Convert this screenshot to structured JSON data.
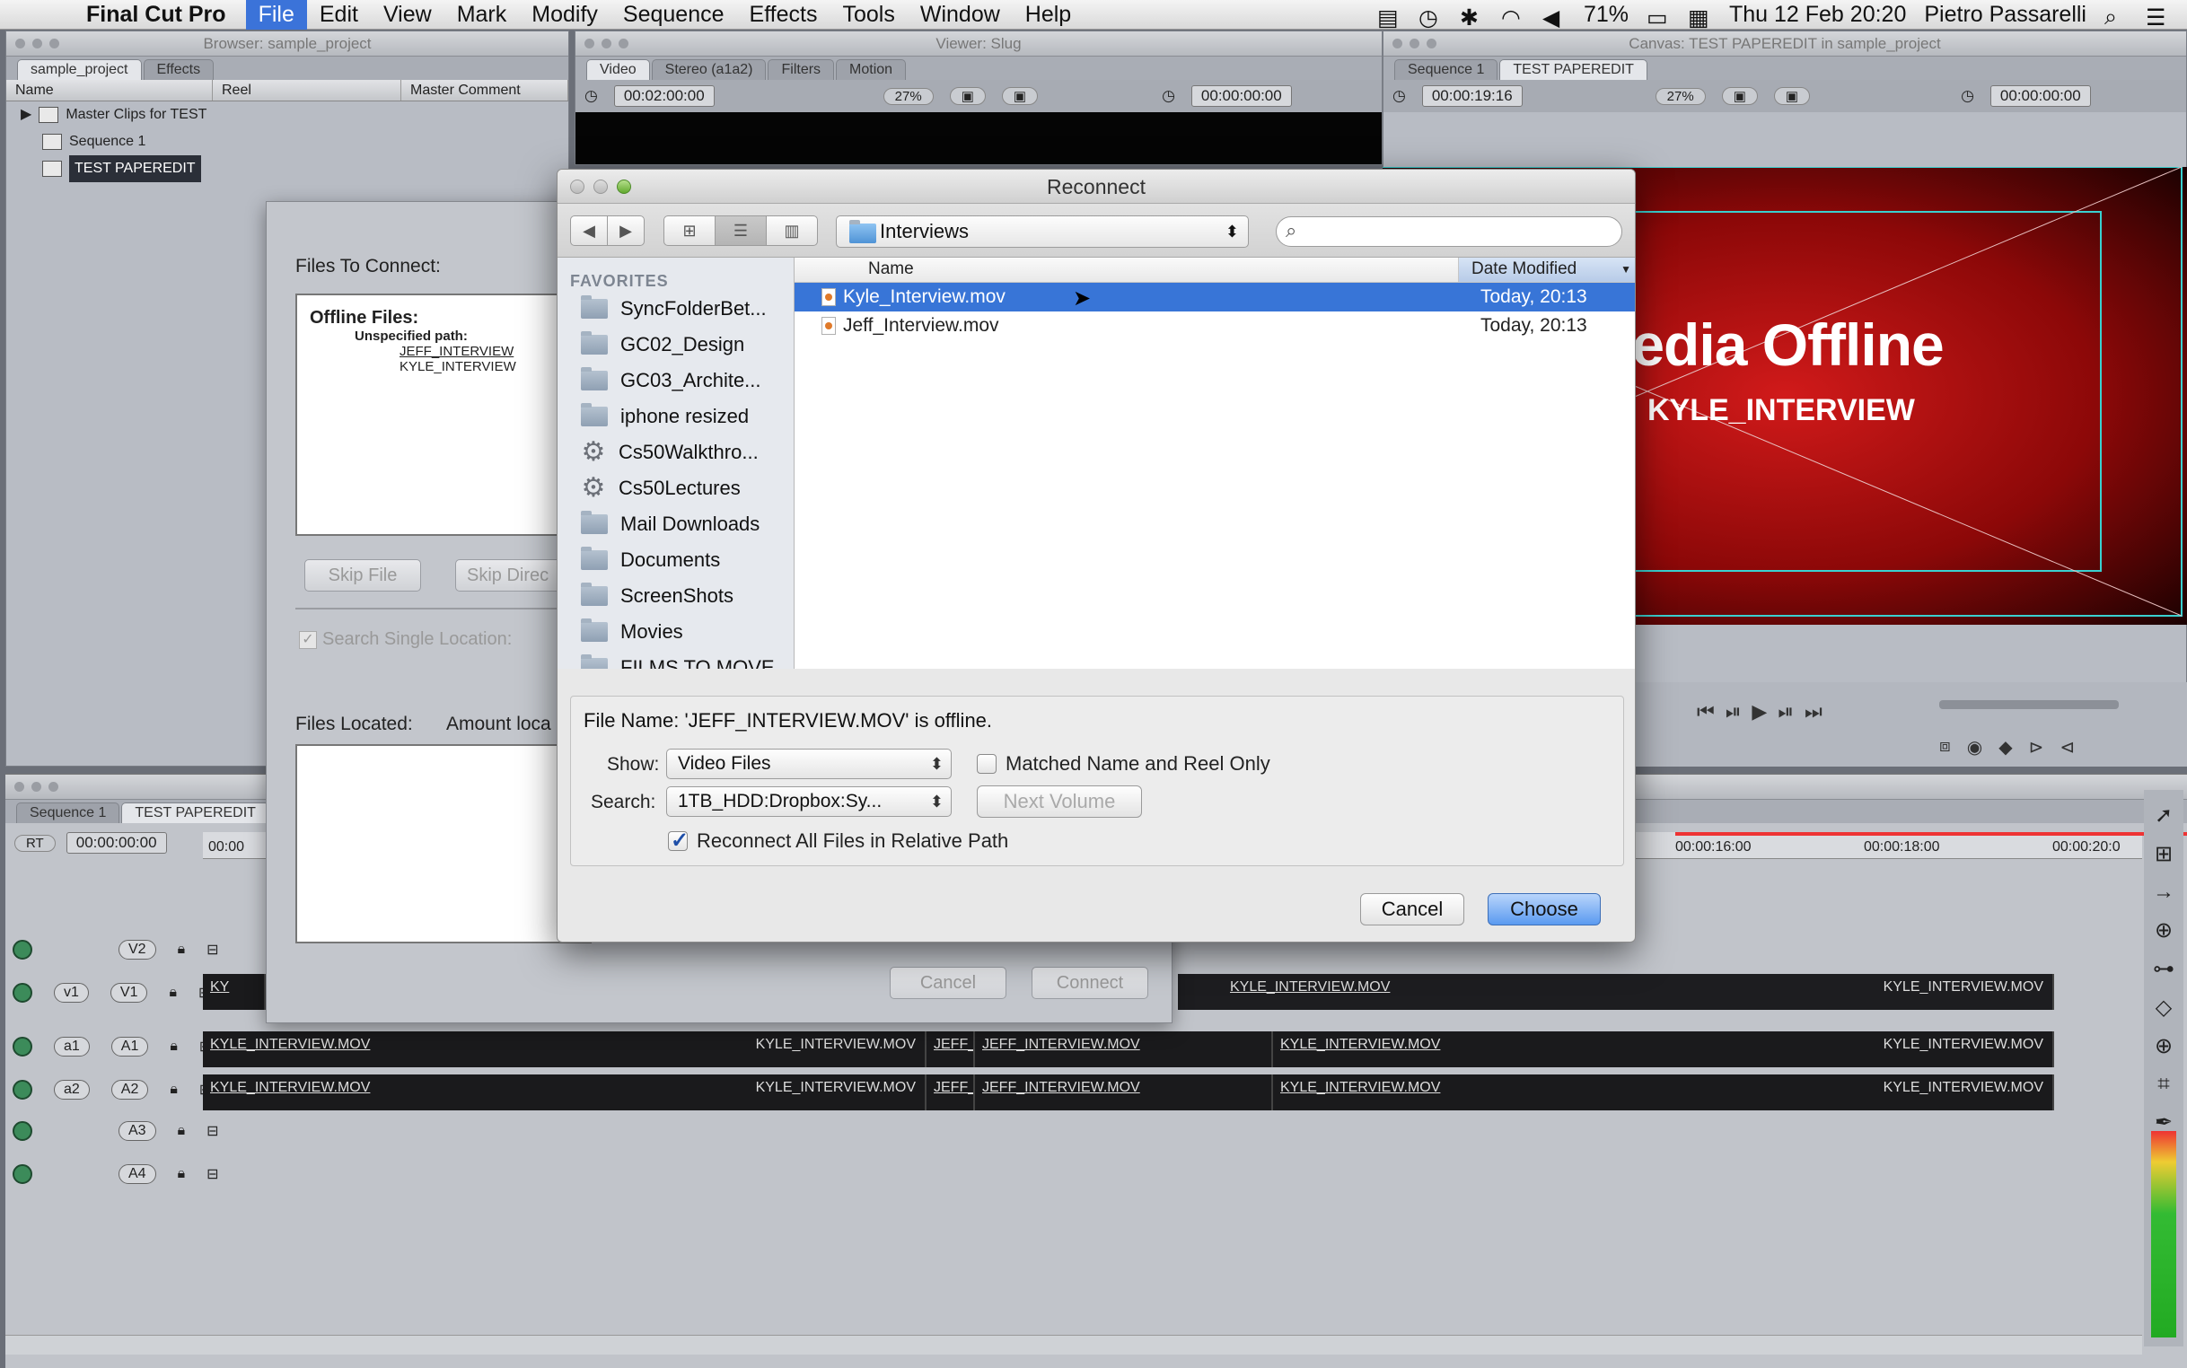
{
  "menubar": {
    "app_name": "Final Cut Pro",
    "items": [
      "File",
      "Edit",
      "View",
      "Mark",
      "Modify",
      "Sequence",
      "Effects",
      "Tools",
      "Window",
      "Help"
    ],
    "active": "File",
    "battery": "71%",
    "datetime": "Thu 12 Feb  20:20",
    "user": "Pietro Passarelli"
  },
  "browser": {
    "title": "Browser: sample_project",
    "tabs": [
      "sample_project",
      "Effects"
    ],
    "columns": [
      "Name",
      "Reel",
      "Master Comment"
    ],
    "rows": [
      "Master Clips for TEST",
      "Sequence 1",
      "TEST PAPEREDIT"
    ]
  },
  "viewer": {
    "title": "Viewer: Slug",
    "tabs": [
      "Video",
      "Stereo (a1a2)",
      "Filters",
      "Motion"
    ],
    "timecode_left": "00:02:00:00",
    "zoom": "27%",
    "timecode_right": "00:00:00:00"
  },
  "canvas": {
    "title": "Canvas: TEST PAPEREDIT in sample_project",
    "tabs": [
      "Sequence 1",
      "TEST PAPEREDIT"
    ],
    "timecode_left": "00:00:19:16",
    "zoom": "27%",
    "timecode_right": "00:00:00:00",
    "offline_title": "ledia Offline",
    "offline_clip": "KYLE_INTERVIEW"
  },
  "reconnect_files": {
    "files_to_connect_label": "Files To Connect:",
    "offline_files_label": "Offline Files:",
    "unspecified_path": "Unspecified path:",
    "files": [
      "JEFF_INTERVIEW",
      "KYLE_INTERVIEW"
    ],
    "skip_file": "Skip File",
    "skip_directory": "Skip Direc",
    "search_single_location": "Search Single Location:",
    "files_located": "Files Located:",
    "amount_located": "Amount loca",
    "cancel": "Cancel",
    "connect": "Connect"
  },
  "timeline": {
    "tabs": [
      "Sequence 1",
      "TEST PAPEREDIT"
    ],
    "rt": "RT",
    "timecode": "00:00:00:00",
    "ruler": [
      "00:00",
      "00:00:16:00",
      "00:00:18:00",
      "00:00:20:0"
    ],
    "tracks": [
      "V2",
      "V1",
      "A1",
      "A2",
      "A3",
      "A4"
    ],
    "sources": [
      "v1",
      "a1",
      "a2"
    ],
    "clip_kyle": "KYLE_INTERVIEW.MOV",
    "clip_jeff": "JEFF_INTERVIEW.MOV",
    "clip_jeff_short": "JEFF_I",
    "clip_kyle_short": "KY"
  },
  "dialog": {
    "title": "Reconnect",
    "path": "Interviews",
    "search_placeholder": "",
    "favorites_label": "FAVORITES",
    "favorites": [
      {
        "label": "SyncFolderBet...",
        "icon": "folder-icon"
      },
      {
        "label": "GC02_Design",
        "icon": "folder-icon"
      },
      {
        "label": "GC03_Archite...",
        "icon": "folder-icon"
      },
      {
        "label": "iphone resized",
        "icon": "folder-icon"
      },
      {
        "label": "Cs50Walkthro...",
        "icon": "gear-icon"
      },
      {
        "label": "Cs50Lectures",
        "icon": "gear-icon"
      },
      {
        "label": "Mail Downloads",
        "icon": "folder-icon"
      },
      {
        "label": "Documents",
        "icon": "folder-icon"
      },
      {
        "label": "ScreenShots",
        "icon": "folder-icon"
      },
      {
        "label": "Movies",
        "icon": "folder-icon"
      },
      {
        "label": "FILMS TO MOVE",
        "icon": "folder-icon"
      }
    ],
    "col_name": "Name",
    "col_date": "Date Modified",
    "files": [
      {
        "name": "Kyle_Interview.mov",
        "date": "Today, 20:13",
        "selected": true
      },
      {
        "name": "Jeff_Interview.mov",
        "date": "Today, 20:13",
        "selected": false
      }
    ],
    "file_name_status": "File Name: 'JEFF_INTERVIEW.MOV' is offline.",
    "show_label": "Show:",
    "show_value": "Video Files",
    "matched_label": "Matched Name and Reel Only",
    "matched_checked": false,
    "search_label": "Search:",
    "search_value": "1TB_HDD:Dropbox:Sy...",
    "next_volume": "Next Volume",
    "reconnect_all_label": "Reconnect All Files in Relative Path",
    "reconnect_all_checked": true,
    "cancel": "Cancel",
    "choose": "Choose"
  },
  "colors": {
    "selection_blue": "#3875d7",
    "offline_red": "#d11a1a",
    "menu_highlight": "#3b73d9"
  }
}
